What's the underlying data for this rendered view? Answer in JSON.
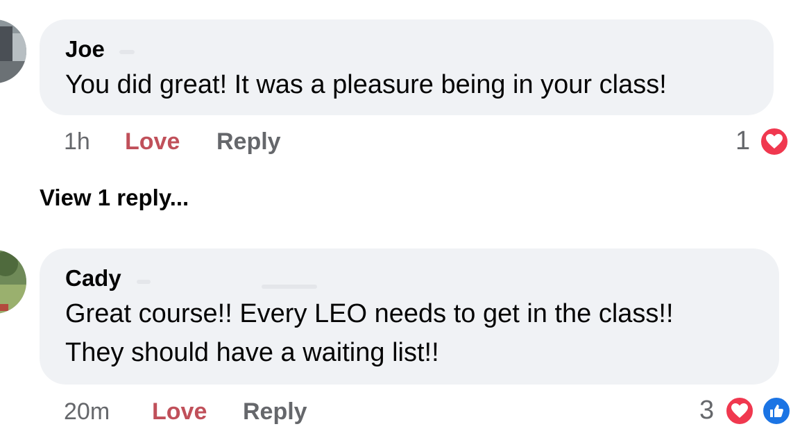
{
  "comments": [
    {
      "author": "Joe",
      "text_lines": [
        "You did great! It was a pleasure being in your class!"
      ],
      "time": "1h",
      "love_label": "Love",
      "reply_label": "Reply",
      "reaction_count": "1",
      "reactions": [
        "heart-icon"
      ]
    },
    {
      "author": "Cady",
      "text_lines": [
        "Great course!! Every LEO needs to get in the class!!",
        "They should have a waiting list!!"
      ],
      "time": "20m",
      "love_label": "Love",
      "reply_label": "Reply",
      "reaction_count": "3",
      "reactions": [
        "heart-icon",
        "like-icon"
      ]
    }
  ],
  "view_replies_label": "View 1 reply...",
  "colors": {
    "bubble": "#f0f2f5",
    "love": "#c0505a",
    "meta": "#65676b",
    "heart": "#f0384f",
    "like": "#1b74e4"
  }
}
